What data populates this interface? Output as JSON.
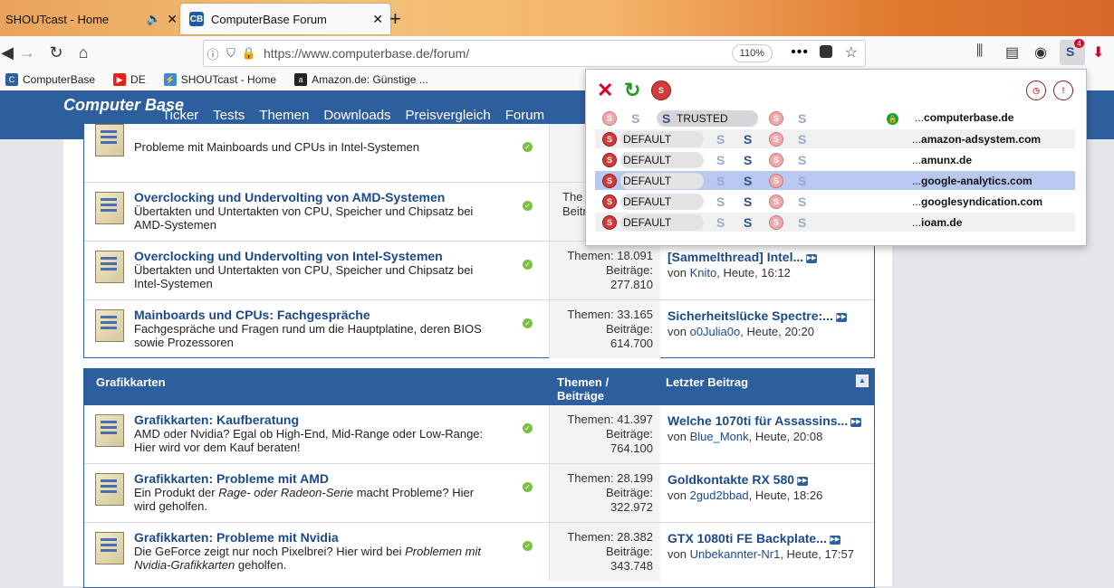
{
  "tabs": [
    {
      "label": "SHOUTcast - Home",
      "audio": true
    },
    {
      "label": "ComputerBase Forum",
      "favicon_text": "CB",
      "active": true
    }
  ],
  "urlbar": {
    "url": "https://www.computerbase.de/forum/",
    "zoom": "110%"
  },
  "noscript_badge": "4",
  "bookmarks": [
    {
      "label": "ComputerBase",
      "color": "#2d5e9e"
    },
    {
      "label": "DE",
      "color": "#e62117"
    },
    {
      "label": "SHOUTcast - Home",
      "color": "#3a8bd6"
    },
    {
      "label": "Amazon.de: Günstige ...",
      "color": "#222222"
    }
  ],
  "site": {
    "logo": "Computer Base",
    "nav": [
      "Ticker",
      "Tests",
      "Themen",
      "Downloads",
      "Preisvergleich",
      "Forum"
    ]
  },
  "forum1": {
    "rows": [
      {
        "title": "",
        "desc": "Probleme mit Mainboards und CPUs in Intel-Systemen",
        "stats1": "Theme",
        "stats2": "",
        "last_title": "",
        "last_by": "",
        "last_user": "",
        "last_time": ""
      },
      {
        "title": "Overclocking und Undervolting von AMD-Systemen",
        "desc": "Übertakten und Untertakten von CPU, Speicher und Chipsatz bei AMD-Systemen",
        "stats1": "The",
        "stats2": "Beiträ",
        "last_title": "",
        "last_by": "",
        "last_user": "",
        "last_time": ""
      },
      {
        "title": "Overclocking und Undervolting von Intel-Systemen",
        "desc": "Übertakten und Untertakten von CPU, Speicher und Chipsatz bei Intel-Systemen",
        "stats1": "Themen: 18.091",
        "stats2": "Beiträge:",
        "stats3": "277.810",
        "last_title": "[Sammelthread] Intel...",
        "last_by": "von",
        "last_user": "Knito",
        "last_time": ", Heute, 16:12"
      },
      {
        "title": "Mainboards und CPUs: Fachgespräche",
        "desc": "Fachgespräche und Fragen rund um die Hauptplatine, deren BIOS sowie Prozessoren",
        "stats1": "Themen: 33.165",
        "stats2": "Beiträge:",
        "stats3": "614.700",
        "last_title": "Sicherheitslücke Spectre:...",
        "last_by": "von",
        "last_user": "o0Julia0o",
        "last_time": ", Heute, 20:20"
      }
    ]
  },
  "forum2": {
    "header": {
      "name": "Grafikkarten",
      "stats": "Themen / Beiträge",
      "last": "Letzter Beitrag"
    },
    "rows": [
      {
        "title": "Grafikkarten: Kaufberatung",
        "desc": "AMD oder Nvidia? Egal ob High-End, Mid-Range oder Low-Range: Hier wird vor dem Kauf beraten!",
        "stats1": "Themen: 41.397",
        "stats2": "Beiträge:",
        "stats3": "764.100",
        "last_title": "Welche 1070ti für Assassins...",
        "last_by": "von",
        "last_user": "Blue_Monk",
        "last_time": ", Heute, 20:08"
      },
      {
        "title": "Grafikkarten: Probleme mit AMD",
        "desc_pre": "Ein Produkt der ",
        "desc_em": "Rage- oder Radeon-Serie",
        "desc_post": " macht Probleme? Hier wird geholfen.",
        "stats1": "Themen: 28.199",
        "stats2": "Beiträge:",
        "stats3": "322.972",
        "last_title": "Goldkontakte RX 580",
        "last_by": "von",
        "last_user": "2gud2bbad",
        "last_time": ", Heute, 18:26"
      },
      {
        "title": "Grafikkarten: Probleme mit Nvidia",
        "desc_pre": "Die GeForce zeigt nur noch Pixelbrei? Hier wird bei ",
        "desc_em": "Problemen mit Nvidia-Grafikkarten",
        "desc_post": " geholfen.",
        "stats1": "Themen: 28.382",
        "stats2": "Beiträge:",
        "stats3": "343.748",
        "last_title": "GTX 1080ti FE Backplate...",
        "last_by": "von",
        "last_user": "Unbekannter-Nr1",
        "last_time": ", Heute, 17:57"
      }
    ]
  },
  "noscript": {
    "rows": [
      {
        "trust": "TRUSTED",
        "domain_prefix": "...",
        "domain": "computerbase.de",
        "secure": true
      },
      {
        "trust": "DEFAULT",
        "domain_prefix": "...",
        "domain": "amazon-adsystem.com"
      },
      {
        "trust": "DEFAULT",
        "domain_prefix": "...",
        "domain": "amunx.de"
      },
      {
        "trust": "DEFAULT",
        "domain_prefix": "...",
        "domain": "google-analytics.com",
        "highlight": true
      },
      {
        "trust": "DEFAULT",
        "domain_prefix": "...",
        "domain": "googlesyndication.com"
      },
      {
        "trust": "DEFAULT",
        "domain_prefix": "...",
        "domain": "ioam.de"
      }
    ]
  }
}
